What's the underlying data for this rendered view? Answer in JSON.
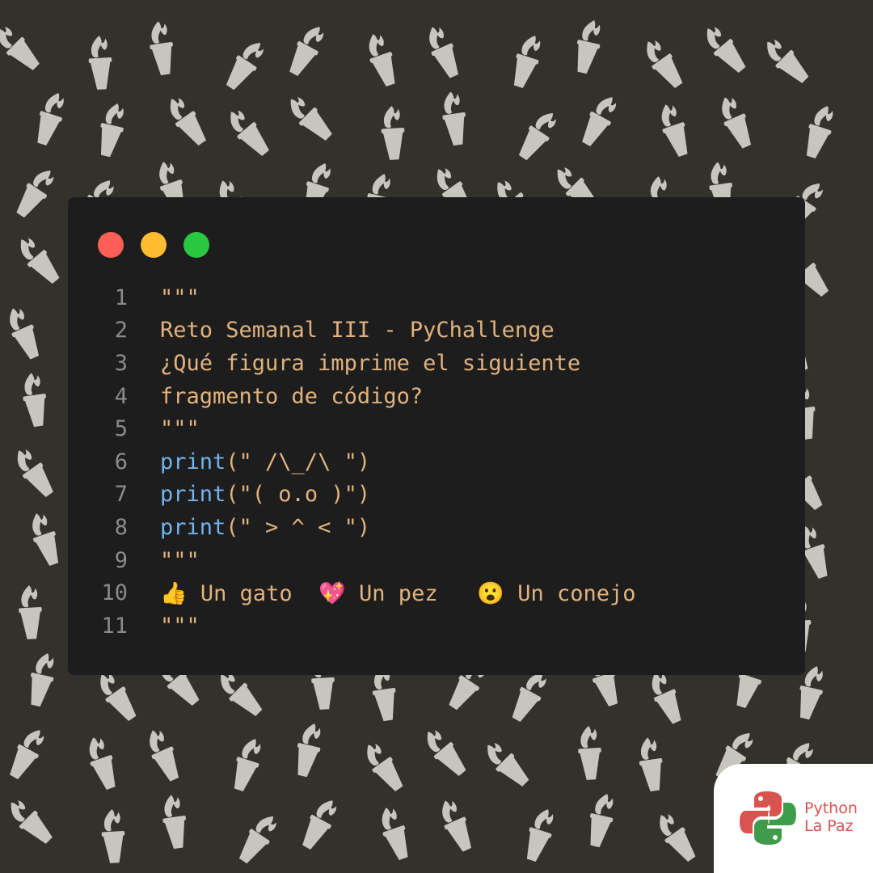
{
  "colors": {
    "background": "#32312b",
    "torch": "#c7c6be",
    "window": "#1d1d1d",
    "code_text": "#e2b27d",
    "keyword": "#74b3f0",
    "line_number": "#8b8b8b",
    "dot_close": "#ff5f57",
    "dot_minimize": "#febc2e",
    "dot_maximize": "#28c840",
    "logo_red": "#d9534f",
    "logo_green": "#3f9c4a"
  },
  "background_icon": "torch-icon",
  "window_controls": [
    "close-dot",
    "minimize-dot",
    "maximize-dot"
  ],
  "code": {
    "lines": [
      {
        "number": "1",
        "keyword": "",
        "text": "\"\"\""
      },
      {
        "number": "2",
        "keyword": "",
        "text": "Reto Semanal III - PyChallenge"
      },
      {
        "number": "3",
        "keyword": "",
        "text": "¿Qué figura imprime el siguiente"
      },
      {
        "number": "4",
        "keyword": "",
        "text": "fragmento de código?"
      },
      {
        "number": "5",
        "keyword": "",
        "text": "\"\"\""
      },
      {
        "number": "6",
        "keyword": "print",
        "text": "(\" /\\_/\\ \")"
      },
      {
        "number": "7",
        "keyword": "print",
        "text": "(\"( o.o )\")"
      },
      {
        "number": "8",
        "keyword": "print",
        "text": "(\" > ^ < \")"
      },
      {
        "number": "9",
        "keyword": "",
        "text": "\"\"\""
      },
      {
        "number": "10",
        "keyword": "",
        "text": "👍 Un gato  💖 Un pez   😮 Un conejo"
      },
      {
        "number": "11",
        "keyword": "",
        "text": "\"\"\""
      }
    ]
  },
  "logo": {
    "line1": "Python",
    "line2": "La Paz",
    "icon": "python-logo-icon"
  }
}
